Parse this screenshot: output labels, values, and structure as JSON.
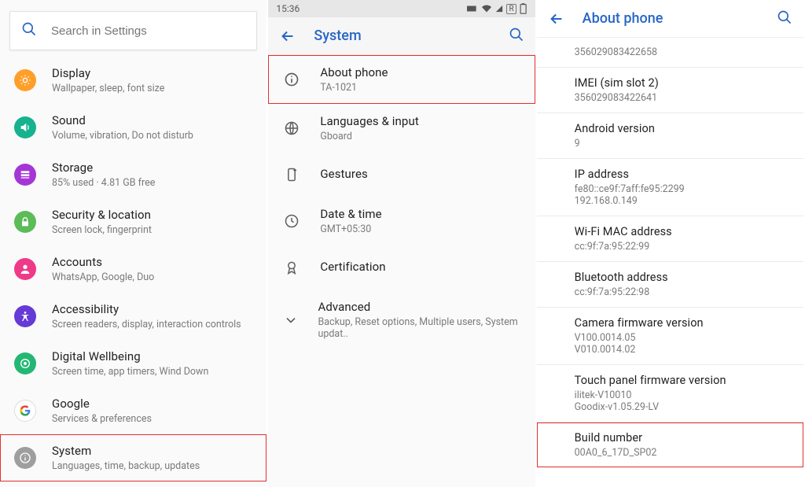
{
  "panel1": {
    "search_placeholder": "Search in Settings",
    "items": [
      {
        "title": "Display",
        "sub": "Wallpaper, sleep, font size",
        "color": "#ff9f2a",
        "icon": "brightness"
      },
      {
        "title": "Sound",
        "sub": "Volume, vibration, Do not disturb",
        "color": "#17b290",
        "icon": "sound"
      },
      {
        "title": "Storage",
        "sub": "85% used · 4.81 GB free",
        "color": "#a536d6",
        "icon": "storage"
      },
      {
        "title": "Security & location",
        "sub": "Screen lock, fingerprint",
        "color": "#5cbc58",
        "icon": "lock"
      },
      {
        "title": "Accounts",
        "sub": "WhatsApp, Google, Duo",
        "color": "#ee3a87",
        "icon": "account"
      },
      {
        "title": "Accessibility",
        "sub": "Screen readers, display, interaction controls",
        "color": "#653ad6",
        "icon": "accessibility"
      },
      {
        "title": "Digital Wellbeing",
        "sub": "Screen time, app timers, Wind Down",
        "color": "#24b774",
        "icon": "wellbeing"
      },
      {
        "title": "Google",
        "sub": "Services & preferences",
        "color": "#ffffff",
        "icon": "google"
      },
      {
        "title": "System",
        "sub": "Languages, time, backup, updates",
        "color": "#9e9e9e",
        "icon": "info"
      }
    ]
  },
  "panel2": {
    "time": "15:36",
    "roaming": "R",
    "title": "System",
    "items": [
      {
        "title": "About phone",
        "sub": "TA-1021",
        "icon": "info",
        "hl": true
      },
      {
        "title": "Languages & input",
        "sub": "Gboard",
        "icon": "globe"
      },
      {
        "title": "Gestures",
        "sub": "",
        "icon": "gestures"
      },
      {
        "title": "Date & time",
        "sub": "GMT+05:30",
        "icon": "clock"
      },
      {
        "title": "Certification",
        "sub": "",
        "icon": "cert"
      },
      {
        "title": "Advanced",
        "sub": "Backup, Reset options, Multiple users, System updat..",
        "icon": "chevron"
      }
    ]
  },
  "panel3": {
    "title": "About phone",
    "items": [
      {
        "title": "",
        "sub": "356029083422658"
      },
      {
        "title": "IMEI (sim slot 2)",
        "sub": "356029083422641"
      },
      {
        "title": "Android version",
        "sub": "9"
      },
      {
        "title": "IP address",
        "sub": "fe80::ce9f:7aff:fe95:2299\n192.168.0.149"
      },
      {
        "title": "Wi-Fi MAC address",
        "sub": "cc:9f:7a:95:22:99"
      },
      {
        "title": "Bluetooth address",
        "sub": "cc:9f:7a:95:22:98"
      },
      {
        "title": "Camera firmware version",
        "sub": "V100.0014.05\nV010.0014.02"
      },
      {
        "title": "Touch panel firmware version",
        "sub": "ilitek-V10010\nGoodix-v1.05.29-LV"
      },
      {
        "title": "Build number",
        "sub": "00A0_6_17D_SP02",
        "hl": true
      }
    ]
  }
}
